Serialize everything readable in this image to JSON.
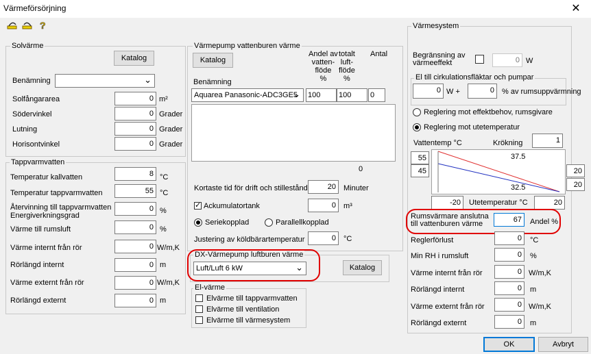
{
  "window": {
    "title": "Värmeförsörjning",
    "close": "✕"
  },
  "toolbar": {
    "icons": [
      "undo-icon",
      "redo-icon",
      "help-icon"
    ]
  },
  "solvarme": {
    "title": "Solvärme",
    "katalog": "Katalog",
    "benamning_label": "Benämning",
    "benamning_value": "",
    "fields": [
      {
        "label": "Solfångararea",
        "value": "0",
        "unit": "m²"
      },
      {
        "label": "Södervinkel",
        "value": "0",
        "unit": "Grader"
      },
      {
        "label": "Lutning",
        "value": "0",
        "unit": "Grader"
      },
      {
        "label": "Horisontvinkel",
        "value": "0",
        "unit": "Grader"
      }
    ]
  },
  "tappvarmvatten": {
    "title": "Tappvarmvatten",
    "fields": [
      {
        "label": "Temperatur kallvatten",
        "value": "8",
        "unit": "°C"
      },
      {
        "label": "Temperatur tappvarmvatten",
        "value": "55",
        "unit": "°C"
      },
      {
        "label": "Återvinning till tappvarmvatten",
        "label2": "Energiverkningsgrad",
        "value": "0",
        "unit": "%"
      },
      {
        "label": "Värme till rumsluft",
        "value": "0",
        "unit": "%"
      },
      {
        "label": "Värme internt från rör",
        "value": "0",
        "unit": "W/m,K"
      },
      {
        "label": "Rörlängd internt",
        "value": "0",
        "unit": "m"
      },
      {
        "label": "Värme externt från rör",
        "value": "0",
        "unit": "W/m,K"
      },
      {
        "label": "Rörlängd externt",
        "value": "0",
        "unit": "m"
      }
    ]
  },
  "vp": {
    "title": "Värmepump vattenburen värme",
    "katalog": "Katalog",
    "col_andel": [
      "Andel av",
      "vatten-",
      "flöde",
      "%"
    ],
    "col_totalt": [
      "totalt",
      "luft-",
      "flöde",
      "%"
    ],
    "col_antal": "Antal",
    "benamning_label": "Benämning",
    "pump_value": "Aquarea Panasonic-ADC3GE5",
    "andel": "100",
    "totalt": "100",
    "antal": "0",
    "list_count": "0",
    "kortaste_label": "Kortaste tid för drift och stillestånd",
    "kortaste_value": "20",
    "kortaste_unit": "Minuter",
    "ackum_label": "Ackumulatortank",
    "ackum_value": "0",
    "ackum_unit": "m³",
    "serie_label": "Seriekopplad",
    "parallell_label": "Parallellkopplad",
    "justering_label": "Justering av köldbärartemperatur",
    "justering_value": "0",
    "justering_unit": "°C"
  },
  "dx": {
    "title": "DX-Värmepump luftburen värme",
    "value": "Luft/Luft 6 kW",
    "katalog": "Katalog"
  },
  "elvarme": {
    "title": "El-värme",
    "items": [
      "Elvärme till tappvarmvatten",
      "Elvärme till ventilation",
      "Elvärme till värmesystem"
    ]
  },
  "varmesystem": {
    "title": "Värmesystem",
    "begr_label": [
      "Begränsning av",
      "värmeeffekt"
    ],
    "begr_value": "0",
    "begr_unit": "W",
    "el_title": "El till cirkulationsfläktar och pumpar",
    "el_w": "0",
    "el_w_unit": "W +",
    "el_pct": "0",
    "el_pct_unit": "% av rumsuppvärmning",
    "reg1": "Reglering mot effektbehov, rumsgivare",
    "reg2": "Reglering mot utetemperatur",
    "vattentemp_label": "Vattentemp °C",
    "krokning_label": "Krökning",
    "krokning_value": "1",
    "vt1": "55",
    "vt2": "45",
    "chart_top": "37.5",
    "chart_bottom": "32.5",
    "rt1": "20",
    "rt2": "20",
    "ute_min": "-20",
    "ute_label": "Utetemperatur °C",
    "ute_max": "20",
    "rums_label": [
      "Rumsvärmare anslutna",
      "till vattenburen värme"
    ],
    "rums_value": "67",
    "rums_unit": "Andel %",
    "fields": [
      {
        "label": "Reglerförlust",
        "value": "0",
        "unit": "°C"
      },
      {
        "label": "Min RH i rumsluft",
        "value": "0",
        "unit": "%"
      },
      {
        "label": "Värme internt från rör",
        "value": "0",
        "unit": "W/m,K"
      },
      {
        "label": "Rörlängd internt",
        "value": "0",
        "unit": "m"
      },
      {
        "label": "Värme externt från rör",
        "value": "0",
        "unit": "W/m,K"
      },
      {
        "label": "Rörlängd externt",
        "value": "0",
        "unit": "m"
      }
    ]
  },
  "buttons": {
    "ok": "OK",
    "cancel": "Avbryt"
  },
  "colors": {
    "highlight": "#e00000",
    "line_red": "#e03030",
    "line_blue": "#2030c0"
  }
}
